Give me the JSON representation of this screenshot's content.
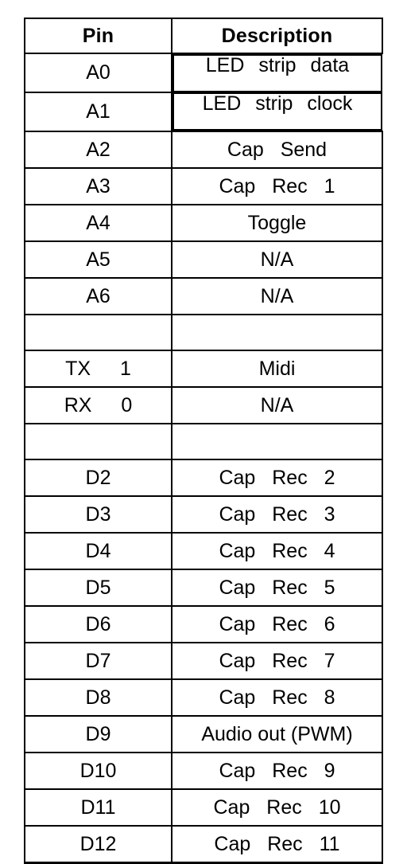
{
  "table": {
    "columns": [
      {
        "key": "pin",
        "label": "Pin"
      },
      {
        "key": "description",
        "label": "Description"
      }
    ],
    "rows": [
      {
        "pin": "A0",
        "description": "LED  strip  data",
        "blank": false,
        "pin_style": "plain",
        "desc_style": "fill"
      },
      {
        "pin": "A1",
        "description": "LED  strip  clock",
        "blank": false,
        "pin_style": "plain",
        "desc_style": "fill"
      },
      {
        "pin": "A2",
        "description": "Cap  Send",
        "blank": false,
        "pin_style": "plain",
        "desc_style": "wide"
      },
      {
        "pin": "A3",
        "description": "Cap  Rec  1",
        "blank": false,
        "pin_style": "plain",
        "desc_style": "wide"
      },
      {
        "pin": "A4",
        "description": "Toggle",
        "blank": false,
        "pin_style": "plain",
        "desc_style": "none"
      },
      {
        "pin": "A5",
        "description": "N/A",
        "blank": false,
        "pin_style": "plain",
        "desc_style": "none"
      },
      {
        "pin": "A6",
        "description": "N/A",
        "blank": false,
        "pin_style": "plain",
        "desc_style": "none"
      },
      {
        "pin": "",
        "description": "",
        "blank": true,
        "pin_style": "plain",
        "desc_style": "none"
      },
      {
        "pin": "TX  1",
        "description": "Midi",
        "blank": false,
        "pin_style": "split",
        "desc_style": "none"
      },
      {
        "pin": "RX  0",
        "description": "N/A",
        "blank": false,
        "pin_style": "split",
        "desc_style": "none"
      },
      {
        "pin": "",
        "description": "",
        "blank": true,
        "pin_style": "plain",
        "desc_style": "none"
      },
      {
        "pin": "D2",
        "description": "Cap  Rec  2",
        "blank": false,
        "pin_style": "plain",
        "desc_style": "wide"
      },
      {
        "pin": "D3",
        "description": "Cap  Rec  3",
        "blank": false,
        "pin_style": "plain",
        "desc_style": "wide"
      },
      {
        "pin": "D4",
        "description": "Cap  Rec  4",
        "blank": false,
        "pin_style": "plain",
        "desc_style": "wide"
      },
      {
        "pin": "D5",
        "description": "Cap  Rec  5",
        "blank": false,
        "pin_style": "plain",
        "desc_style": "wide"
      },
      {
        "pin": "D6",
        "description": "Cap  Rec  6",
        "blank": false,
        "pin_style": "plain",
        "desc_style": "wide"
      },
      {
        "pin": "D7",
        "description": "Cap  Rec  7",
        "blank": false,
        "pin_style": "plain",
        "desc_style": "wide"
      },
      {
        "pin": "D8",
        "description": "Cap  Rec  8",
        "blank": false,
        "pin_style": "plain",
        "desc_style": "wide"
      },
      {
        "pin": "D9",
        "description": "Audio out (PWM)",
        "blank": false,
        "pin_style": "plain",
        "desc_style": "none"
      },
      {
        "pin": "D10",
        "description": "Cap  Rec  9",
        "blank": false,
        "pin_style": "plain",
        "desc_style": "wide"
      },
      {
        "pin": "D11",
        "description": "Cap  Rec  10",
        "blank": false,
        "pin_style": "plain",
        "desc_style": "wide"
      },
      {
        "pin": "D12",
        "description": "Cap  Rec  11",
        "blank": false,
        "pin_style": "plain",
        "desc_style": "wide"
      }
    ]
  },
  "style": {
    "background_color": "#ffffff",
    "text_color": "#000000",
    "border_color": "#000000"
  }
}
